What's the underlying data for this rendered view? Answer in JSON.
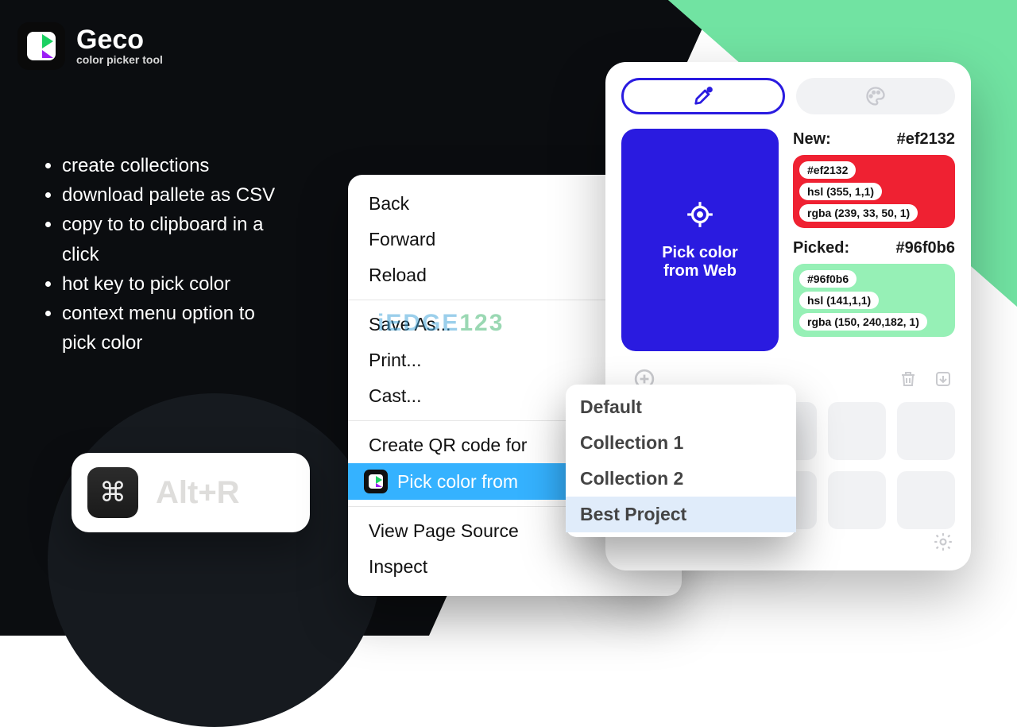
{
  "brand": {
    "name": "Geco",
    "tagline": "color picker tool"
  },
  "features": [
    "create collections",
    "download pallete as CSV",
    "copy to to clipboard in a click",
    "hot key to pick color",
    "context menu option to pick color"
  ],
  "hotkey": {
    "label": "Alt+R",
    "modifier_symbol": "⌘"
  },
  "context_menu": {
    "items": {
      "back": "Back",
      "forward": "Forward",
      "reload": "Reload",
      "save_as": "Save As...",
      "print": "Print...",
      "cast": "Cast...",
      "qr": "Create QR code for",
      "pick": "Pick color from",
      "view_source": "View Page Source",
      "inspect": "Inspect"
    }
  },
  "collections_dropdown": {
    "items": [
      "Default",
      "Collection 1",
      "Collection 2",
      "Best Project"
    ],
    "selected_index": 3
  },
  "popup": {
    "pick_button": {
      "line1": "Pick color",
      "line2": "from Web"
    },
    "new_label": "New:",
    "new_hex": "#ef2132",
    "new_values": {
      "hex": "#ef2132",
      "hsl": "hsl (355, 1,1)",
      "rgba": "rgba (239, 33, 50, 1)"
    },
    "picked_label": "Picked:",
    "picked_hex": "#96f0b6",
    "picked_values": {
      "hex": "#96f0b6",
      "hsl": "hsl (141,1,1)",
      "rgba": "rgba (150, 240,182, 1)"
    }
  },
  "watermark": "iEDGE123"
}
